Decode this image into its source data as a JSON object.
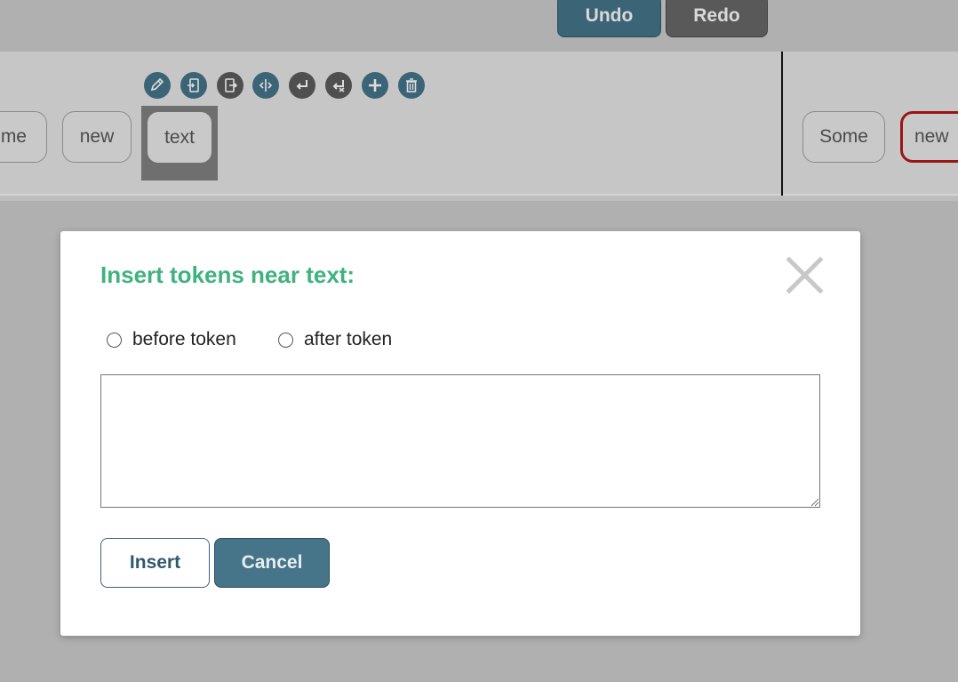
{
  "header": {
    "undo_label": "Undo",
    "redo_label": "Redo"
  },
  "tokens": {
    "left_partial": "me",
    "left_new": "new",
    "selected": "text",
    "right_some": "Some",
    "right_new": "new"
  },
  "toolbar_icons": [
    "pencil-edit-icon",
    "merge-left-icon",
    "merge-right-icon",
    "split-icon",
    "line-break-icon",
    "remove-line-break-icon",
    "add-icon",
    "delete-icon"
  ],
  "dialog": {
    "title": "Insert tokens near text:",
    "option_before": "before token",
    "option_after": "after token",
    "textarea_value": "",
    "insert_label": "Insert",
    "cancel_label": "Cancel"
  },
  "colors": {
    "accent_blue": "#3c6477",
    "title_green": "#3fb27f",
    "selected_border_red": "#9b1515"
  }
}
